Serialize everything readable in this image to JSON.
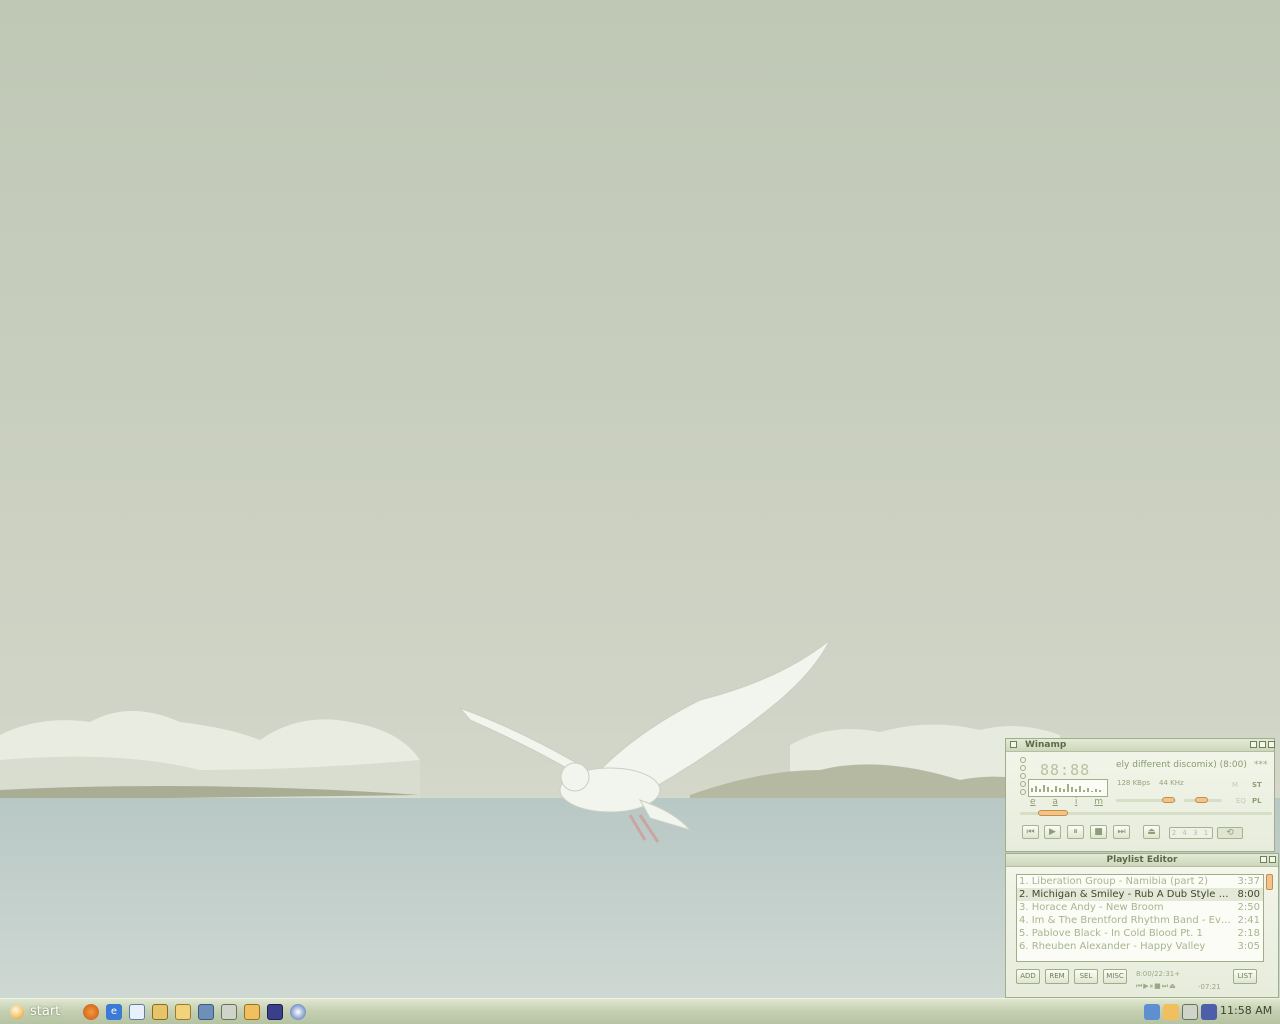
{
  "taskbar": {
    "start_label": "start",
    "quick_launch": [
      "firefox-icon",
      "ie-icon",
      "notepad-icon",
      "briefcase-icon",
      "folder-icon",
      "network-icon",
      "recycle-icon",
      "paint-icon",
      "equalizer-icon",
      "media-player-icon"
    ],
    "tray_icons": [
      "network-connections-icon",
      "paint-tray-icon",
      "recycle-tray-icon",
      "monitor-tray-icon"
    ],
    "clock": "11:58 AM"
  },
  "winamp": {
    "title": "Winamp",
    "time": "88:88",
    "song_title": "ely different discomix) (8:00)",
    "stars": "***",
    "kbps": "128 KBps",
    "khz": "44 KHz",
    "mono_label": "M",
    "stereo_label": "ST",
    "eq_label": "EQ",
    "pl_label": "PL",
    "letters": [
      "e",
      "a",
      "i",
      "m"
    ],
    "shuffle_label": "2 4 3 1",
    "controls": {
      "prev": "⏮",
      "play": "▶",
      "pause": "⏸",
      "stop": "■",
      "next": "⏭",
      "eject": "⏏",
      "repeat": "⟲"
    }
  },
  "playlist": {
    "title": "Playlist Editor",
    "items": [
      {
        "title": "1. Liberation Group - Namibia (part 2)",
        "duration": "3:37"
      },
      {
        "title": "2. Michigan & Smiley - Rub A Dub Style (co…",
        "duration": "8:00"
      },
      {
        "title": "3. Horace Andy - New Broom",
        "duration": "2:50"
      },
      {
        "title": "4. Im & The Brentford Rhythm Band - Eve…",
        "duration": "2:41"
      },
      {
        "title": "5. Pablove Black - In Cold Blood Pt. 1",
        "duration": "2:18"
      },
      {
        "title": "6. Rheuben Alexander - Happy Valley",
        "duration": "3:05"
      }
    ],
    "buttons": {
      "add": "ADD",
      "rem": "REM",
      "sel": "SEL",
      "misc": "MISC",
      "list": "LIST"
    },
    "total_time": "8:00/22:31+",
    "remaining": "-07:21"
  },
  "colors": {
    "sky": "#c5ccbb",
    "water": "#bccbc6",
    "winamp_bg": "#eef2e4",
    "accent": "#f2c48a"
  }
}
